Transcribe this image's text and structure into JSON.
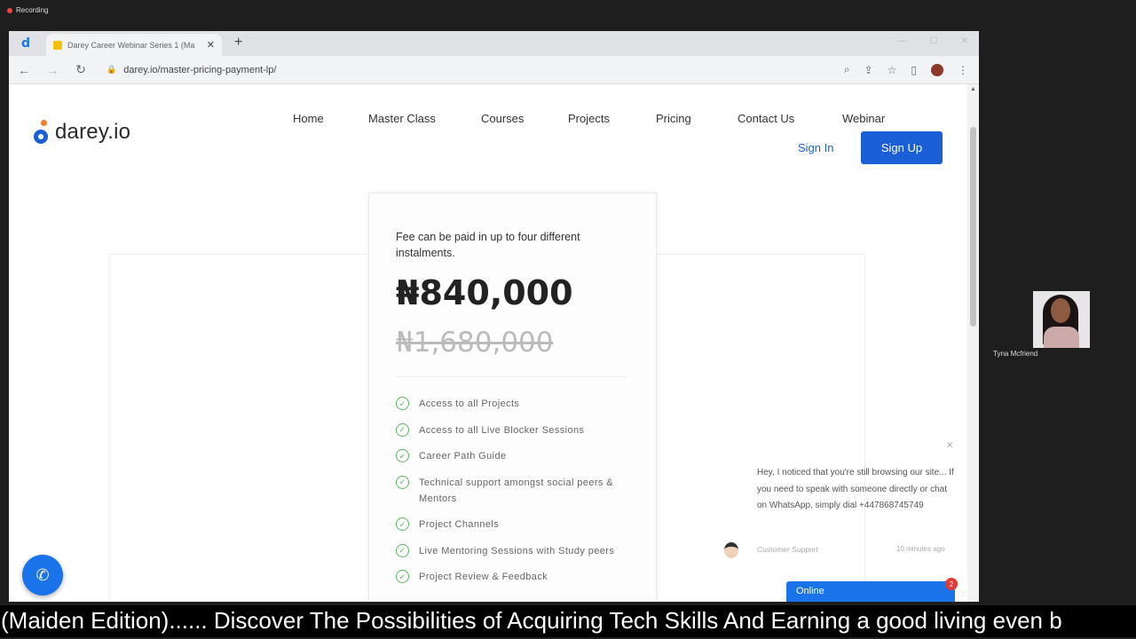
{
  "recording": {
    "label": "Recording"
  },
  "browser": {
    "tab_title": "Darey Career Webinar Series 1 (Ma",
    "new_tab": "+",
    "tab_close": "✕",
    "url": "darey.io/master-pricing-payment-lp/"
  },
  "site": {
    "logo_text": "darey.io",
    "nav": [
      "Home",
      "Master Class",
      "Courses",
      "Projects",
      "Pricing",
      "Contact Us",
      "Webinar"
    ],
    "sign_in": "Sign In",
    "sign_up": "Sign Up"
  },
  "pricing_card": {
    "note": "Fee can be paid in up to four different instalments.",
    "price": "₦840,000",
    "old_price": "₦1,680,000",
    "features": [
      "Access to all Projects",
      "Access to all Live Blocker Sessions",
      "Career Path Guide",
      "Technical support amongst social peers & Mentors",
      "Project Channels",
      "Live Mentoring Sessions with Study peers",
      "Project Review & Feedback"
    ]
  },
  "chat": {
    "message": "Hey, I noticed that you're still browsing our site... If you need to speak with someone directly or chat on WhatsApp, simply dial +447868745749",
    "agent": "Customer Support",
    "time": "10 minutes ago",
    "status": "Online",
    "badge": "2"
  },
  "participant": {
    "name": "Tyna Mcfriend"
  },
  "caption": "(Maiden Edition)...... Discover The Possibilities of Acquiring Tech Skills And Earning a good living even b",
  "colors": {
    "brand_blue": "#1a5fd6",
    "logo_orange": "#f07d2a",
    "check_green": "#5cb85c"
  }
}
